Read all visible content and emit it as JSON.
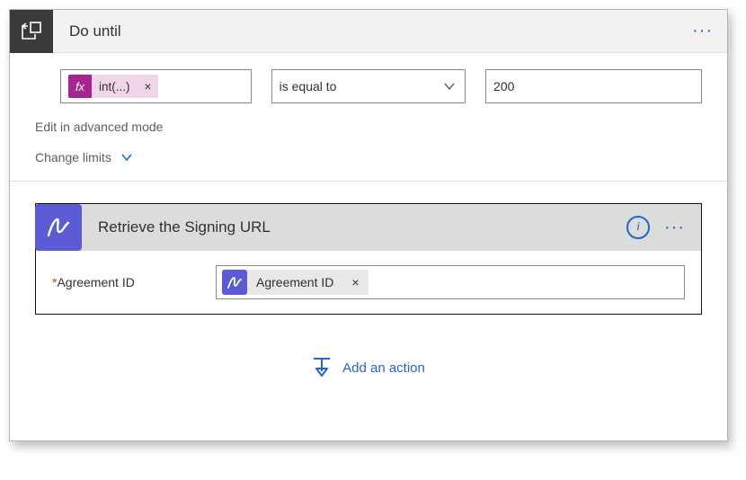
{
  "header": {
    "title": "Do until"
  },
  "condition": {
    "fx_prefix": "fx",
    "fx_label": "int(...)",
    "operator": "is equal to",
    "value": "200"
  },
  "links": {
    "edit_advanced": "Edit in advanced mode",
    "change_limits": "Change limits"
  },
  "action": {
    "title": "Retrieve the Signing URL",
    "field_label": "Agreement ID",
    "token_label": "Agreement ID"
  },
  "footer": {
    "add_action": "Add an action"
  }
}
